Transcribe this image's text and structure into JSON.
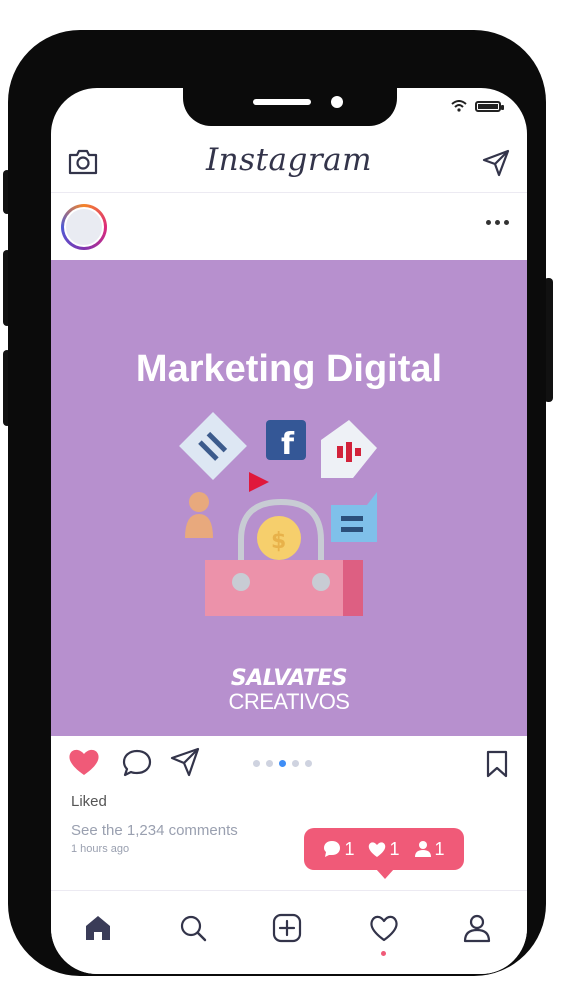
{
  "app": {
    "title": "Instagram"
  },
  "post": {
    "image_title": "Marketing Digital",
    "logo_line1": "SALVATES",
    "logo_line2": "CREATIVOS",
    "liked_label": "Liked",
    "comments_link": "See the 1,234 comments",
    "time_ago": "1 hours ago",
    "carousel": {
      "total": 5,
      "active_index": 2
    }
  },
  "notifications": {
    "comments": "1",
    "likes": "1",
    "followers": "1"
  },
  "colors": {
    "image_bg": "#b790ce",
    "like_red": "#f05a78",
    "accent_blue": "#3f8ef6",
    "text_dark": "#33344a"
  },
  "icons": {
    "topbar": [
      "camera-icon",
      "send-icon"
    ],
    "actions": [
      "heart-icon",
      "comment-icon",
      "share-icon",
      "bookmark-icon"
    ],
    "nav": [
      "home-icon",
      "search-icon",
      "add-icon",
      "activity-heart-icon",
      "profile-icon"
    ]
  }
}
